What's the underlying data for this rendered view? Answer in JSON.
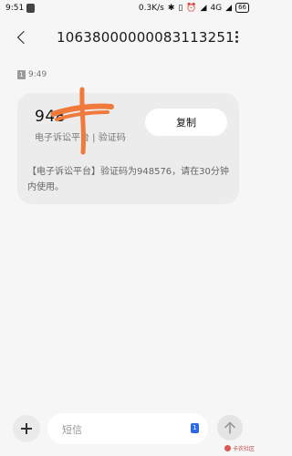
{
  "status_bar": {
    "time": "9:51",
    "speed": "0.3K/s",
    "network": "4G",
    "battery": "66"
  },
  "header": {
    "title": "10638000000083113251"
  },
  "message": {
    "sim_slot": "1",
    "time": "9:49",
    "code_visible": "948",
    "code_source": "电子诉讼平台 | 验证码",
    "copy_label": "复制",
    "body": "【电子诉讼平台】验证码为948576，请在30分钟内使用。"
  },
  "input_bar": {
    "placeholder": "短信",
    "sim_badge": "1"
  },
  "watermark": {
    "text": "卡农社区"
  },
  "colors": {
    "scribble": "#f07a3c",
    "sim_badge": "#2d6ae8"
  }
}
